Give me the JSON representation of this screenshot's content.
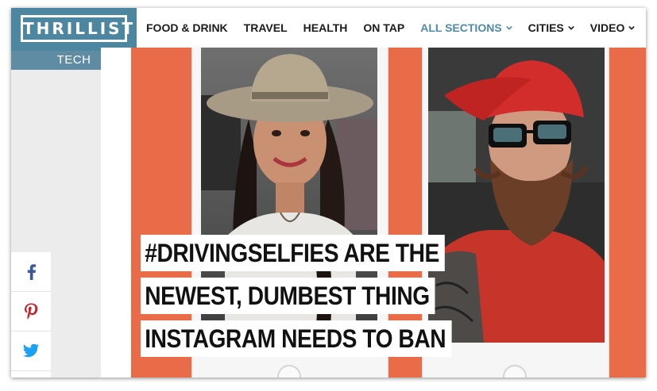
{
  "brand": {
    "logo_text": "THRILLIST",
    "section": "TECH",
    "accent": "#4f8ba6"
  },
  "nav": {
    "items": [
      {
        "label": "FOOD & DRINK",
        "dropdown": false,
        "active": false
      },
      {
        "label": "TRAVEL",
        "dropdown": false,
        "active": false
      },
      {
        "label": "HEALTH",
        "dropdown": false,
        "active": false
      },
      {
        "label": "ON TAP",
        "dropdown": false,
        "active": false
      },
      {
        "label": "ALL SECTIONS",
        "dropdown": true,
        "active": true
      },
      {
        "label": "CITIES",
        "dropdown": true,
        "active": false
      },
      {
        "label": "VIDEO",
        "dropdown": true,
        "active": false
      }
    ]
  },
  "share": {
    "buttons": [
      {
        "icon": "facebook-icon",
        "color": "#3b5998"
      },
      {
        "icon": "pinterest-icon",
        "color": "#cb2027"
      },
      {
        "icon": "twitter-icon",
        "color": "#1da1f2"
      }
    ],
    "mini_icon": "facebook-badge-icon"
  },
  "hero": {
    "headline_lines": [
      "#DRIVINGSELFIES ARE THE",
      "NEWEST, DUMBEST THING",
      "INSTAGRAM NEEDS TO BAN"
    ],
    "stripe_color": "#ea6b47"
  }
}
